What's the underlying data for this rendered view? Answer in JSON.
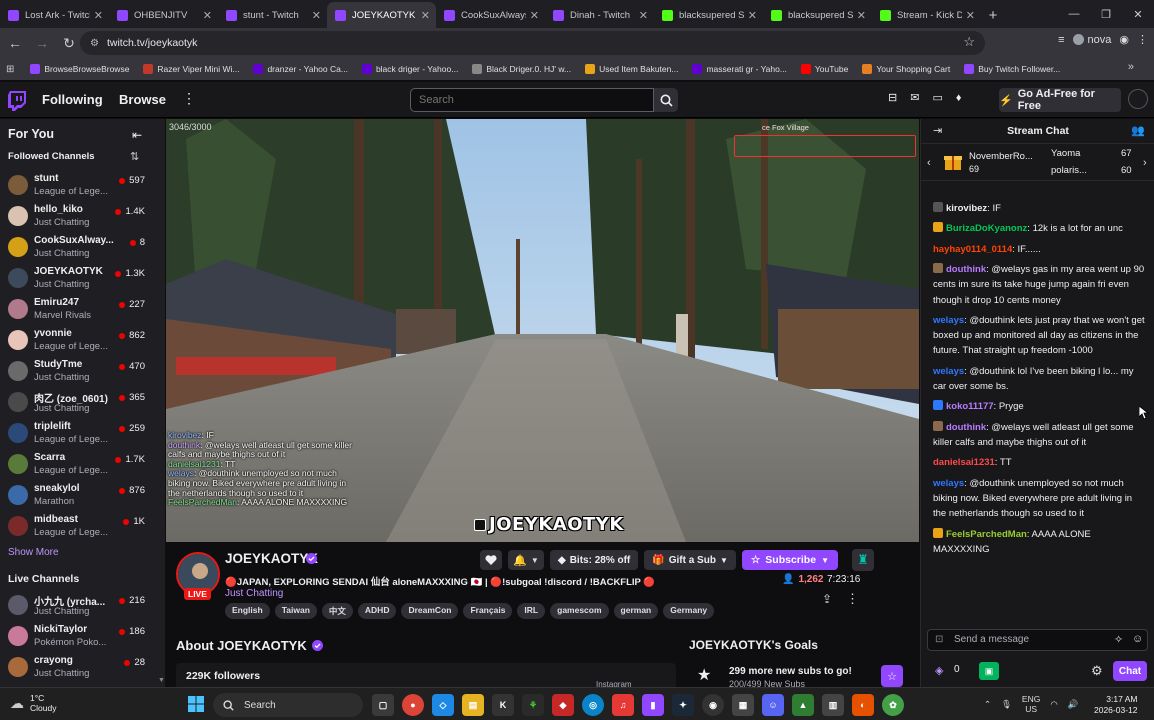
{
  "browser": {
    "tabs": [
      {
        "title": "Lost Ark - Twitch",
        "color": "#9147ff"
      },
      {
        "title": "OHBENJITV",
        "color": "#9147ff"
      },
      {
        "title": "stunt - Twitch",
        "color": "#9147ff"
      },
      {
        "title": "JOEYKAOTYK",
        "color": "#9147ff",
        "active": true
      },
      {
        "title": "CookSuxAlways",
        "color": "#9147ff"
      },
      {
        "title": "Dinah - Twitch",
        "color": "#9147ff"
      },
      {
        "title": "blacksupered St",
        "color": "#53fc18"
      },
      {
        "title": "blacksupered St",
        "color": "#53fc18"
      },
      {
        "title": "Stream - Kick Da",
        "color": "#53fc18"
      }
    ],
    "url": "twitch.tv/joeykaotyk",
    "profile_name": "nova",
    "bookmarks": [
      {
        "label": "BrowseBrowseBrowse",
        "color": "#9147ff"
      },
      {
        "label": "Razer Viper Mini Wi...",
        "color": "#c0392b"
      },
      {
        "label": "dranzer - Yahoo Ca...",
        "color": "#6001d2"
      },
      {
        "label": "black driger - Yahoo...",
        "color": "#6001d2"
      },
      {
        "label": "Black Driger.0. HJ' w...",
        "color": "#888888"
      },
      {
        "label": "Used Item Bakuten...",
        "color": "#e8a317"
      },
      {
        "label": "masserati gr - Yaho...",
        "color": "#6001d2"
      },
      {
        "label": "YouTube",
        "color": "#ff0000"
      },
      {
        "label": "Your Shopping Cart",
        "color": "#e67e22"
      },
      {
        "label": "Buy Twitch Follower...",
        "color": "#9147ff"
      }
    ]
  },
  "nav": {
    "following": "Following",
    "browse": "Browse",
    "search_placeholder": "Search",
    "ad_free": "Go Ad-Free for Free"
  },
  "sidebar": {
    "for_you": "For You",
    "followed_title": "Followed Channels",
    "show_more": "Show More",
    "live_title": "Live Channels",
    "followed": [
      {
        "name": "stunt",
        "game": "League of Lege...",
        "viewers": "597",
        "color": "#7a5c3b"
      },
      {
        "name": "hello_kiko",
        "game": "Just Chatting",
        "viewers": "1.4K",
        "color": "#d9c3b0"
      },
      {
        "name": "CookSuxAlway...",
        "game": "Just Chatting",
        "viewers": "8",
        "color": "#d4a017"
      },
      {
        "name": "JOEYKAOTYK",
        "game": "Just Chatting",
        "viewers": "1.3K",
        "color": "#3d4a5c"
      },
      {
        "name": "Emiru247",
        "game": "Marvel Rivals",
        "viewers": "227",
        "color": "#b07a8a"
      },
      {
        "name": "yvonnie",
        "game": "League of Lege...",
        "viewers": "862",
        "color": "#e8c5b8"
      },
      {
        "name": "StudyTme",
        "game": "Just Chatting",
        "viewers": "470",
        "color": "#6a6a6a"
      },
      {
        "name": "肉乙 (zoe_0601)",
        "game": "Just Chatting",
        "viewers": "365",
        "color": "#4a4a4a"
      },
      {
        "name": "triplelift",
        "game": "League of Lege...",
        "viewers": "259",
        "color": "#2b4a7a"
      },
      {
        "name": "Scarra",
        "game": "League of Lege...",
        "viewers": "1.7K",
        "color": "#5a7a3a"
      },
      {
        "name": "sneakylol",
        "game": "Marathon",
        "viewers": "876",
        "color": "#3a6aa8"
      },
      {
        "name": "midbeast",
        "game": "League of Lege...",
        "viewers": "1K",
        "color": "#7a2a2a"
      }
    ],
    "live": [
      {
        "name": "小九九 (yrcha...",
        "game": "Just Chatting",
        "viewers": "216",
        "color": "#5a5a6a"
      },
      {
        "name": "NickiTaylor",
        "game": "Pokémon Poko...",
        "viewers": "186",
        "color": "#c97a9a"
      },
      {
        "name": "crayong",
        "game": "Just Chatting",
        "viewers": "28",
        "color": "#a86a3a"
      }
    ]
  },
  "video": {
    "counter": "3046/3000",
    "sign": "ce Fox Village",
    "logo_text": "JOEYKAOTYK",
    "overlay_chat": [
      {
        "user": "kirovibez",
        "text": ": IF",
        "cls": "u1"
      },
      {
        "user": "douthink",
        "text": ": @welays well atleast ull get some killer calfs and maybe thighs out of it",
        "cls": "u2"
      },
      {
        "user": "danielsai1231",
        "text": ": TT",
        "cls": "u3"
      },
      {
        "user": "welays",
        "text": ": @douthink unemployed so not much biking now. Biked everywhere pre adult living in the netherlands though so used to it",
        "cls": "u1"
      },
      {
        "user": "FeelsParchedMan",
        "text": ": AAAA ALONE MAXXXXING",
        "cls": "u3"
      }
    ]
  },
  "stream": {
    "streamer": "JOEYKAOTYK",
    "live": "LIVE",
    "title": "🔴JAPAN, EXPLORING SENDAI 仙台 aloneMAXXXING 🇯🇵 | 🔴!subgoal !discord / !BACKFLIP 🔴",
    "category": "Just Chatting",
    "tags": [
      "English",
      "Taiwan",
      "中文",
      "ADHD",
      "DreamCon",
      "Français",
      "IRL",
      "gamescom",
      "german",
      "Germany"
    ],
    "bits": "Bits: 28% off",
    "gift": "Gift a Sub",
    "subscribe": "Subscribe",
    "viewers": "1,262",
    "uptime": "7:23:16",
    "about": "About JOEYKAOTYK",
    "followers": "229K followers",
    "instagram": "Instagram",
    "goals_title": "JOEYKAOTYK's Goals",
    "goal_text": "299 more new subs to go!",
    "goal_sub": "200/499 New Subs"
  },
  "chat": {
    "title": "Stream Chat",
    "leaders": [
      {
        "name": "NovemberRo...",
        "count": "69"
      },
      {
        "name": "Yaoma",
        "count": "67"
      },
      {
        "name": "polaris...",
        "count": "60"
      }
    ],
    "messages": [
      {
        "user": "kirovibez",
        "color": "#efeff1",
        "text": ": IF",
        "badge": "#555555"
      },
      {
        "user": "BurizaDoKyanonz",
        "color": "#00c853",
        "text": ": 12k is a lot for an unc",
        "badge": "#e8a317"
      },
      {
        "user": "hayhay0114_0114",
        "color": "#ff4500",
        "text": ": IF......",
        "badge": ""
      },
      {
        "user": "douthink",
        "color": "#b77cff",
        "text": ": @welays gas in my area went up 90 cents im sure its take huge jump again fri even though it drop 10 cents money",
        "badge": "#8a6a4a"
      },
      {
        "user": "welays",
        "color": "#2e78ff",
        "text": ": @douthink lets just pray that we won't get boxed up and monitored all day as citizens in the future. That straight up freedom -1000",
        "badge": ""
      },
      {
        "user": "welays",
        "color": "#2e78ff",
        "text": ": @douthink lol I've been biking l lo... my car over some bs.",
        "badge": ""
      },
      {
        "user": "koko11177",
        "color": "#b77cff",
        "text": ": Pryge",
        "badge": "#2e78ff"
      },
      {
        "user": "douthink",
        "color": "#b77cff",
        "text": ": @welays well atleast ull get some killer calfs and maybe thighs out of it",
        "badge": "#8a6a4a"
      },
      {
        "user": "danielsai1231",
        "color": "#ff4a4a",
        "text": ": TT",
        "badge": ""
      },
      {
        "user": "welays",
        "color": "#2e78ff",
        "text": ": @douthink unemployed so not much biking now. Biked everywhere pre adult living in the netherlands though so used to it",
        "badge": ""
      },
      {
        "user": "FeelsParchedMan",
        "color": "#9acd32",
        "text": ": AAAA ALONE MAXXXXING",
        "badge": "#e8a317"
      }
    ],
    "input_placeholder": "Send a message",
    "points": "0",
    "chat_button": "Chat"
  },
  "taskbar": {
    "temp": "1°C",
    "weather": "Cloudy",
    "search": "Search",
    "lang1": "ENG",
    "lang2": "US",
    "time": "3:17 AM",
    "date": "2026-03-12"
  }
}
